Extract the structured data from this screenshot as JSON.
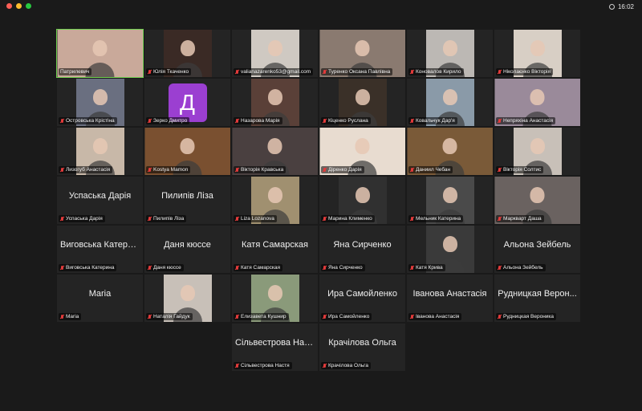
{
  "window": {
    "time": "16:02"
  },
  "tiles": [
    {
      "name": "Патрилевич",
      "mode": "video",
      "bg": "#c9a99a",
      "muted": false,
      "active": true,
      "wide": true
    },
    {
      "name": "Юлія Ткаченко",
      "mode": "video",
      "bg": "#3a2a25",
      "muted": true
    },
    {
      "name": "valianazarenko53@gmail.com",
      "mode": "video",
      "bg": "#cfc9c2",
      "muted": true
    },
    {
      "name": "Туренко Оксана Павлівна",
      "mode": "video",
      "bg": "#8a7a70",
      "muted": true,
      "wide": true
    },
    {
      "name": "Коновалов Кирило",
      "mode": "video",
      "bg": "#bcb8b4",
      "muted": true
    },
    {
      "name": "Ніколаєнко Вікторія",
      "mode": "video",
      "bg": "#d8cfc5",
      "muted": true
    },
    {
      "name": "Островська Крістіна",
      "mode": "video",
      "bg": "#6a6f80",
      "muted": true
    },
    {
      "name": "Зерко Дмитро",
      "mode": "avatar",
      "letter": "Д",
      "muted": true
    },
    {
      "name": "Назарова Марія",
      "mode": "video",
      "bg": "#5a4038",
      "muted": true
    },
    {
      "name": "Кіценко Руслана",
      "mode": "video",
      "bg": "#3a3028",
      "muted": true
    },
    {
      "name": "Ковальчук Дар'я",
      "mode": "video",
      "bg": "#8a9aa8",
      "muted": true
    },
    {
      "name": "Непряхіна Анастасія",
      "mode": "video",
      "bg": "#9a8a9a",
      "muted": true,
      "wide": true
    },
    {
      "name": "Лизогуб Анастасія",
      "mode": "video",
      "bg": "#c8b8a8",
      "muted": true
    },
    {
      "name": "Kostya Mamon",
      "mode": "video",
      "bg": "#7a5030",
      "muted": true,
      "wide": true
    },
    {
      "name": "Вікторія Кравська",
      "mode": "video",
      "bg": "#4a4040",
      "muted": true,
      "wide": true
    },
    {
      "name": "Діренко Дарія",
      "mode": "video",
      "bg": "#e8dcd0",
      "muted": true,
      "wide": true
    },
    {
      "name": "Даниил Чебан",
      "mode": "video",
      "bg": "#7a5a38",
      "muted": true,
      "wide": true
    },
    {
      "name": "Вікторія Солтис",
      "mode": "video",
      "bg": "#c8c0b8",
      "muted": true
    },
    {
      "name": "Успаська Дарія",
      "mode": "name",
      "muted": true
    },
    {
      "name": "Пилипів Ліза",
      "mode": "name",
      "muted": true
    },
    {
      "name": "Liza Lozanova",
      "mode": "video",
      "bg": "#a09070",
      "muted": true
    },
    {
      "name": "Марина Клименко",
      "mode": "video",
      "bg": "#303030",
      "muted": true
    },
    {
      "name": "Мельник Катерина",
      "mode": "video",
      "bg": "#4a4a4a",
      "muted": true
    },
    {
      "name": "Маркварт Даша",
      "mode": "video",
      "bg": "#6a6260",
      "muted": true,
      "wide": true
    },
    {
      "name": "Виговська Катерина",
      "big": "Виговська Катери...",
      "mode": "name",
      "muted": true
    },
    {
      "name": "Даня кюссе",
      "mode": "name",
      "muted": true
    },
    {
      "name": "Катя Самарская",
      "mode": "name",
      "muted": true
    },
    {
      "name": "Яна Сирченко",
      "mode": "name",
      "muted": true
    },
    {
      "name": "Катя Крива",
      "mode": "video",
      "bg": "#3a3a3a",
      "muted": true
    },
    {
      "name": "Альона Зейбель",
      "mode": "name",
      "muted": true
    },
    {
      "name": "Maria",
      "mode": "name",
      "muted": true
    },
    {
      "name": "Наталія Гайдук",
      "mode": "video",
      "bg": "#c8c0b8",
      "muted": true
    },
    {
      "name": "Елизавета Кушнир",
      "mode": "video",
      "bg": "#8a9a7a",
      "muted": true
    },
    {
      "name": "Ира Самойленко",
      "mode": "name",
      "muted": true
    },
    {
      "name": "Іванова Анастасія",
      "mode": "name",
      "muted": true
    },
    {
      "name": "Рудницкая Вероника",
      "big": "Рудницкая Верон...",
      "mode": "name",
      "muted": true
    },
    {
      "name": "",
      "mode": "empty"
    },
    {
      "name": "",
      "mode": "empty"
    },
    {
      "name": "Сільвестрова Настя",
      "big": "Сільвестрова Нас...",
      "mode": "name",
      "muted": true
    },
    {
      "name": "Крачілова Ольга",
      "mode": "name",
      "muted": true
    },
    {
      "name": "",
      "mode": "empty"
    },
    {
      "name": "",
      "mode": "empty"
    }
  ]
}
